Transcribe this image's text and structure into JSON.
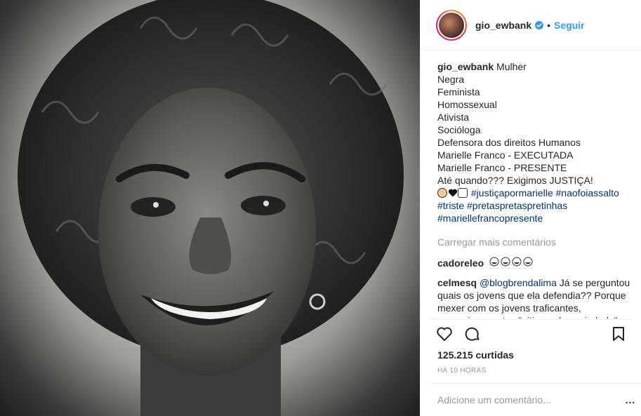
{
  "post": {
    "username": "gio_ewbank",
    "follow_label": "Seguir",
    "caption_lines": [
      "Mulher",
      "Negra",
      "Feminista",
      "Homossexual",
      "Ativista",
      "Socióloga",
      "Defensora dos direitos Humanos",
      "Marielle Franco - EXECUTADA",
      "Marielle Franco - PRESENTE",
      "Até quando??? Exigimos JUSTIÇA!"
    ],
    "hashtags": [
      "#justiçapormarielle",
      "#naofoiassalto",
      "#triste",
      "#pretaspretaspretinhas",
      "#mariellefrancopresente"
    ],
    "load_more_label": "Carregar mais comentários",
    "comments": [
      {
        "user": "cadoreleo",
        "text": ""
      },
      {
        "user": "celmesq",
        "mention": "@blogbrendalima",
        "text": "Já se perguntou quais os jovens que ela defendia?? Porque mexer com os jovens traficantes, assassinos e etc.. \"vítimas da sociedade\" e querer"
      }
    ],
    "likes": "125.215 curtidas",
    "time_ago": "HÁ 10 HORAS",
    "comment_placeholder": "Adicione um comentário...",
    "more_label": "..."
  },
  "icons": {
    "verified": "verified-badge-icon",
    "like": "heart-icon",
    "comment": "comment-bubble-icon",
    "save": "bookmark-icon"
  },
  "colors": {
    "link": "#3897f0",
    "hashtag": "#003569",
    "muted": "#999999",
    "border": "#efefef"
  }
}
